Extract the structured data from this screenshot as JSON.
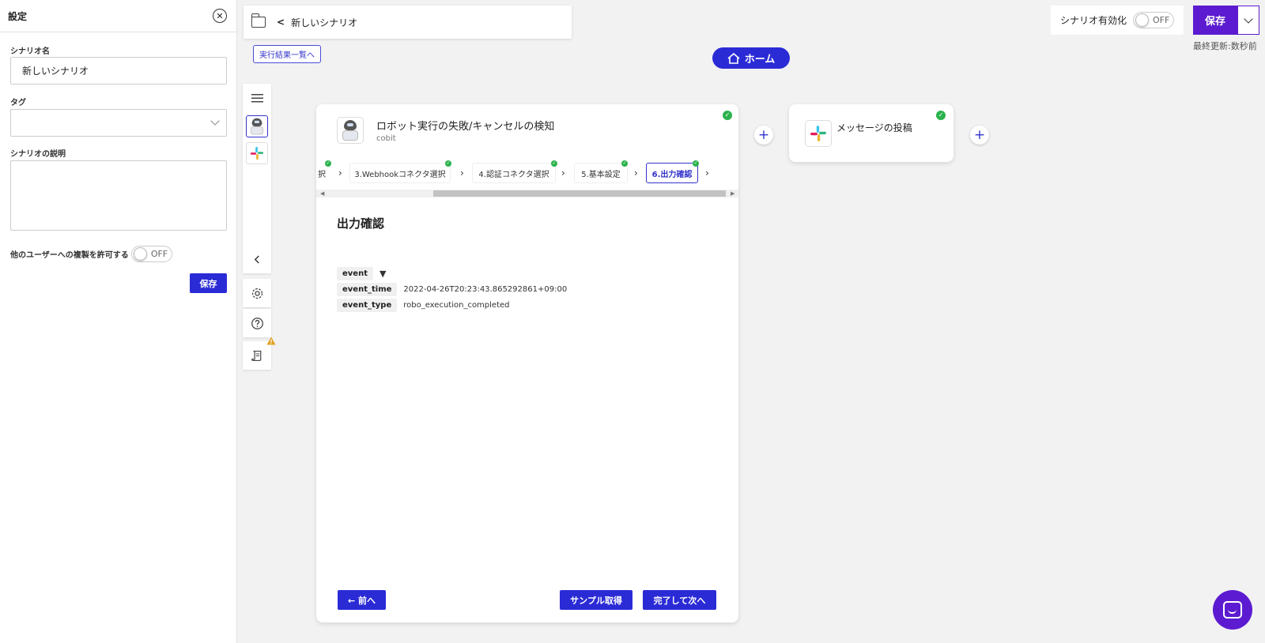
{
  "settings_panel": {
    "title": "設定",
    "scenario_name_label": "シナリオ名",
    "scenario_name_value": "新しいシナリオ",
    "tag_label": "タグ",
    "description_label": "シナリオの説明",
    "copy_permission_label": "他のユーザーへの複製を許可する",
    "copy_toggle": "OFF",
    "save_label": "保存"
  },
  "breadcrumb": {
    "back_chevron": "<",
    "title": "新しいシナリオ"
  },
  "results_link": "実行結果一覧へ",
  "home_button": "ホーム",
  "header": {
    "activate_label": "シナリオ有効化",
    "activate_toggle": "OFF",
    "save_label": "保存",
    "last_update": "最終更新:数秒前"
  },
  "robot_card": {
    "title": "ロボット実行の失敗/キャンセルの検知",
    "subtitle": "cobit",
    "steps": [
      {
        "label": "択",
        "done": true
      },
      {
        "label": "3.Webhookコネクタ選択",
        "done": true
      },
      {
        "label": "4.認証コネクタ選択",
        "done": true
      },
      {
        "label": "5.基本設定",
        "done": true
      },
      {
        "label": "6.出力確認",
        "done": true,
        "active": true
      }
    ],
    "section_title": "出力確認",
    "fields": [
      {
        "key": "event",
        "value": "▼"
      },
      {
        "key": "event_time",
        "value": "2022-04-26T20:23:43.865292861+09:00"
      },
      {
        "key": "event_type",
        "value": "robo_execution_completed"
      }
    ],
    "prev_button": "← 前へ",
    "sample_button": "サンプル取得",
    "next_button": "完了して次へ"
  },
  "slack_card": {
    "title": "メッセージの投稿"
  },
  "colors": {
    "primary": "#2b2bd6",
    "accent": "#5c1bd0",
    "success": "#2bb24c",
    "warning": "#e0a020"
  },
  "icons": [
    "close-icon",
    "folder-icon",
    "home-icon",
    "list-icon",
    "robot-icon",
    "slack-icon",
    "chevron-left-icon",
    "gear-icon",
    "help-icon",
    "script-icon",
    "warning-icon",
    "chat-icon",
    "plus-icon",
    "check-icon"
  ]
}
